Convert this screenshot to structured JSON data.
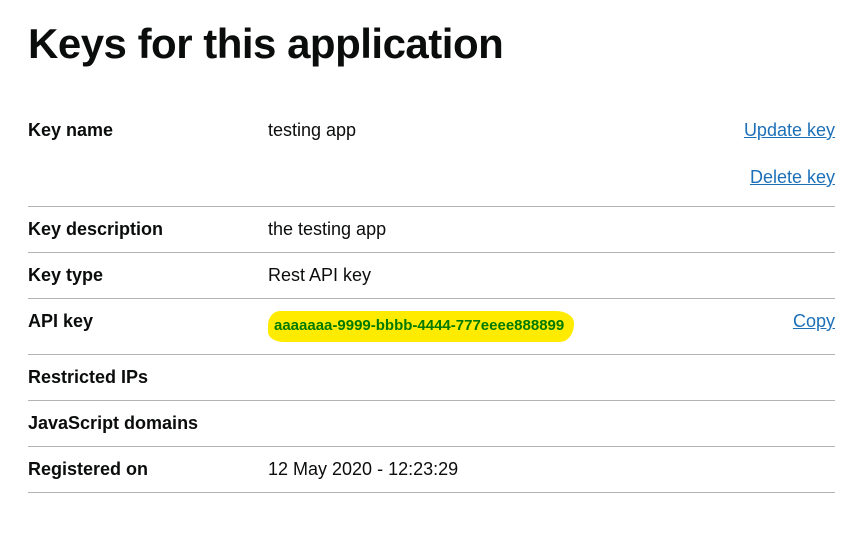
{
  "title": "Keys for this application",
  "rows": {
    "key_name": {
      "label": "Key name",
      "value": "testing app"
    },
    "key_description": {
      "label": "Key description",
      "value": "the testing app"
    },
    "key_type": {
      "label": "Key type",
      "value": "Rest API key"
    },
    "api_key": {
      "label": "API key",
      "value": "aaaaaaa-9999-bbbb-4444-777eeee888899"
    },
    "restricted_ips": {
      "label": "Restricted IPs",
      "value": ""
    },
    "javascript_domains": {
      "label": "JavaScript domains",
      "value": ""
    },
    "registered_on": {
      "label": "Registered on",
      "value": "12 May 2020 - 12:23:29"
    }
  },
  "actions": {
    "update": "Update key",
    "delete": "Delete key",
    "copy": "Copy"
  }
}
